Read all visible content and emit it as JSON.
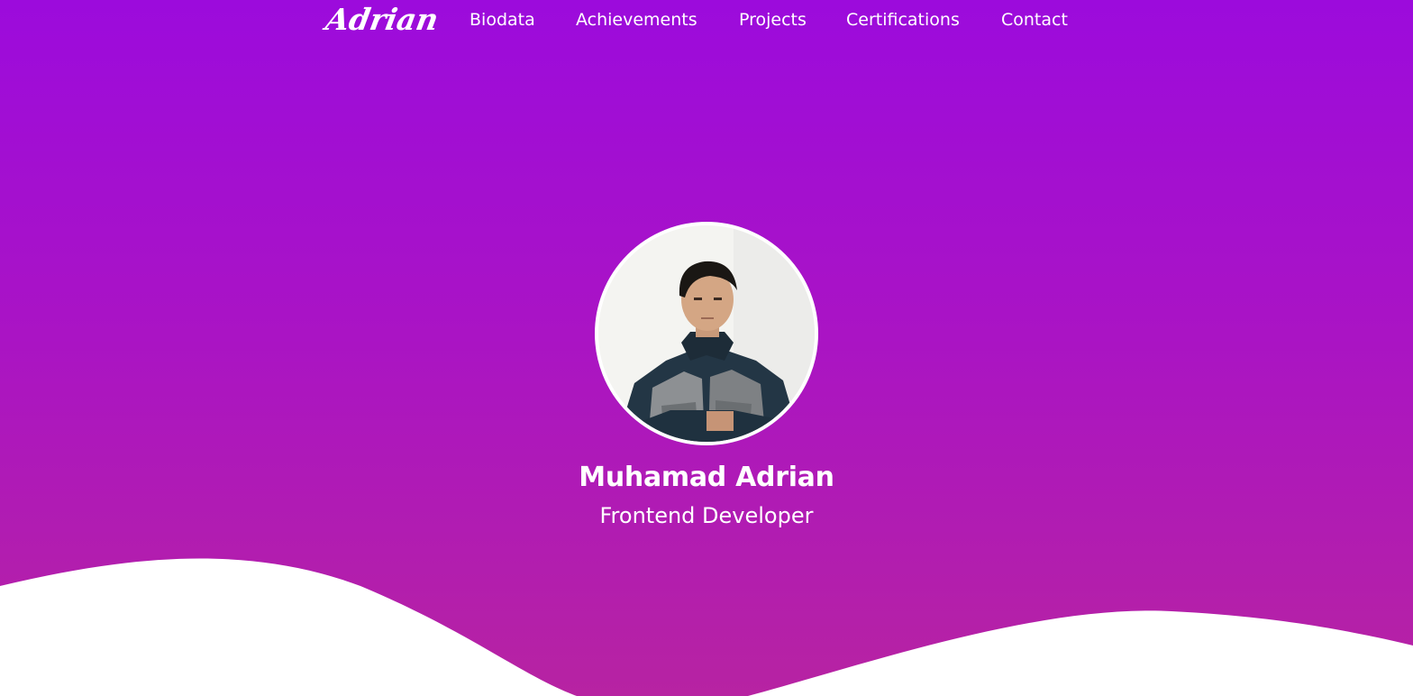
{
  "nav": {
    "brand": "Adrian",
    "links": [
      "Biodata",
      "Achievements",
      "Projects",
      "Certifications",
      "Contact"
    ]
  },
  "profile": {
    "name": "Muhamad Adrian",
    "role": "Frontend Developer"
  },
  "colors": {
    "gradient_top": "#9c0bdc",
    "gradient_bottom": "#b723a2",
    "text": "#ffffff",
    "wave": "#ffffff"
  }
}
